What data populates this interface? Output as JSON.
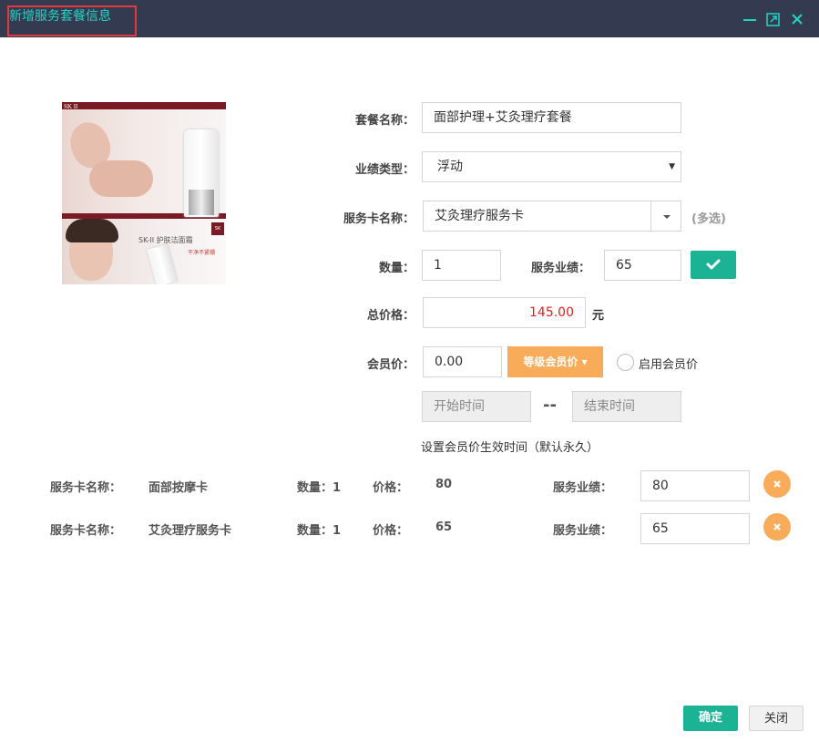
{
  "dialog": {
    "title": "新增服务套餐信息",
    "icons": [
      "minimize-icon",
      "maximize-icon",
      "close-icon"
    ]
  },
  "product_image": {
    "brand": "SK II",
    "caption": "SK-II 护肤洁面霜",
    "subcaption": "干净不紧绷"
  },
  "form": {
    "package_name_label": "套餐名称：",
    "package_name_value": "面部护理+艾灸理疗套餐",
    "perf_type_label": "业绩类型：",
    "perf_type_value": "浮动",
    "service_card_label": "服务卡名称：",
    "service_card_value": "艾灸理疗服务卡",
    "service_card_hint": "(多选)",
    "quantity_label": "数量：",
    "quantity_value": "1",
    "service_perf_label": "服务业绩：",
    "service_perf_value": "65",
    "total_price_label": "总价格：",
    "total_price_value": "145.00",
    "total_price_unit": "元",
    "member_price_label": "会员价：",
    "member_price_value": "0.00",
    "level_member_price_btn": "等级会员价",
    "enable_member_price_label": "启用会员价",
    "start_time_placeholder": "开始时间",
    "end_time_placeholder": "结束时间",
    "time_separator": "--",
    "time_hint": "设置会员价生效时间（默认永久）"
  },
  "cards": [
    {
      "name_label": "服务卡名称：",
      "name": "面部按摩卡",
      "qty_text": "数量：1",
      "price_label": "价格：",
      "price": "80",
      "perf_label": "服务业绩：",
      "perf": "80"
    },
    {
      "name_label": "服务卡名称：",
      "name": "艾灸理疗服务卡",
      "qty_text": "数量：1",
      "price_label": "价格：",
      "price": "65",
      "perf_label": "服务业绩：",
      "perf": "65"
    }
  ],
  "footer": {
    "confirm": "确定",
    "close": "关闭"
  },
  "colors": {
    "titlebar": "#343b51",
    "accent_teal": "#1cb394",
    "accent_orange": "#f8ac59",
    "price_red": "#e02020"
  }
}
